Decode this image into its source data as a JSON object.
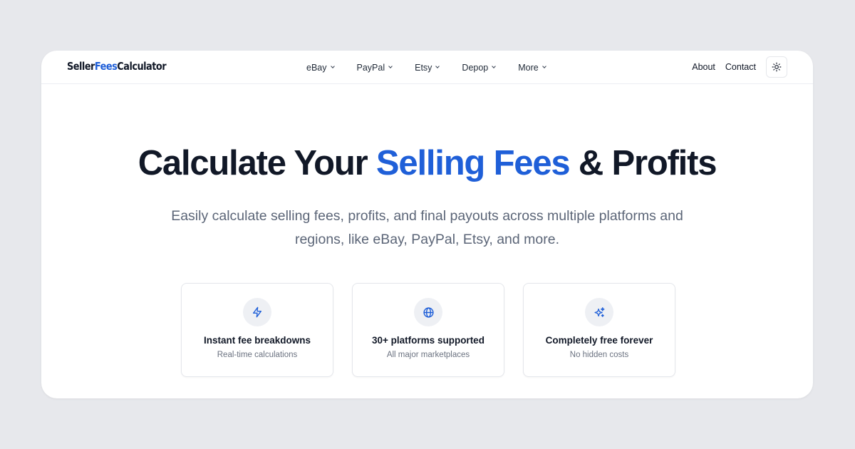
{
  "brand": {
    "part1": "Seller",
    "part2": "Fees",
    "part3": "Calculator",
    "accent_color": "#1f5fd8"
  },
  "nav": {
    "items": [
      {
        "label": "eBay"
      },
      {
        "label": "PayPal"
      },
      {
        "label": "Etsy"
      },
      {
        "label": "Depop"
      },
      {
        "label": "More"
      }
    ],
    "about": "About",
    "contact": "Contact",
    "theme_toggle_icon": "sun-icon"
  },
  "hero": {
    "title_start": "Calculate Your ",
    "title_accent": "Selling Fees",
    "title_end": " & Profits",
    "subtitle": "Easily calculate selling fees, profits, and final payouts across multiple platforms and regions, like eBay, PayPal, Etsy, and more."
  },
  "features": [
    {
      "icon": "lightning-icon",
      "title": "Instant fee breakdowns",
      "subtitle": "Real-time calculations"
    },
    {
      "icon": "globe-icon",
      "title": "30+ platforms supported",
      "subtitle": "All major marketplaces"
    },
    {
      "icon": "sparkles-icon",
      "title": "Completely free forever",
      "subtitle": "No hidden costs"
    }
  ]
}
